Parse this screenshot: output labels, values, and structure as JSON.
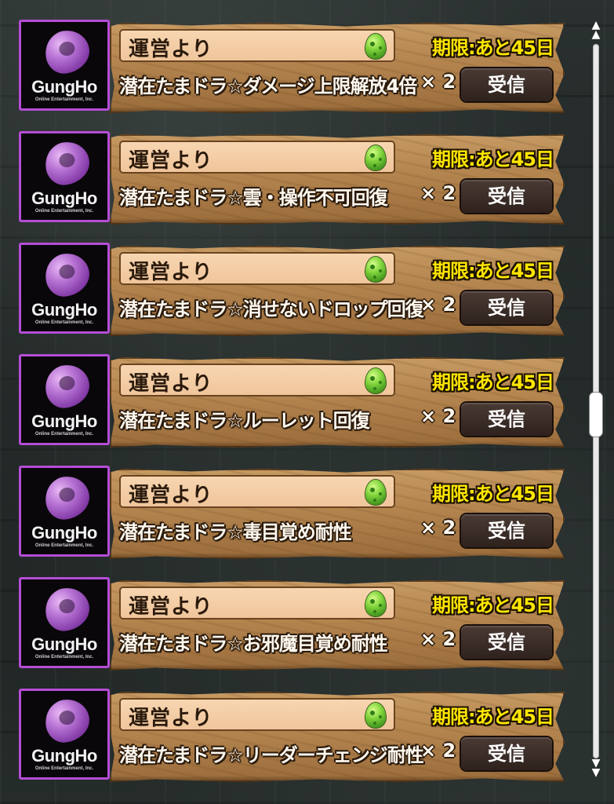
{
  "mail": {
    "items": [
      {
        "sender_logo": {
          "name": "GungHo",
          "sub": "Online Entertainment, Inc."
        },
        "sender": "運営より",
        "deadline": "期限:あと45日",
        "item": "潜在たまドラ☆ダメージ上限解放4倍",
        "qty": "× 2",
        "receive_label": "受信"
      },
      {
        "sender_logo": {
          "name": "GungHo",
          "sub": "Online Entertainment, Inc."
        },
        "sender": "運営より",
        "deadline": "期限:あと45日",
        "item": "潜在たまドラ☆雲・操作不可回復",
        "qty": "× 2",
        "receive_label": "受信"
      },
      {
        "sender_logo": {
          "name": "GungHo",
          "sub": "Online Entertainment, Inc."
        },
        "sender": "運営より",
        "deadline": "期限:あと45日",
        "item": "潜在たまドラ☆消せないドロップ回復",
        "qty": "× 2",
        "receive_label": "受信"
      },
      {
        "sender_logo": {
          "name": "GungHo",
          "sub": "Online Entertainment, Inc."
        },
        "sender": "運営より",
        "deadline": "期限:あと45日",
        "item": "潜在たまドラ☆ルーレット回復",
        "qty": "× 2",
        "receive_label": "受信"
      },
      {
        "sender_logo": {
          "name": "GungHo",
          "sub": "Online Entertainment, Inc."
        },
        "sender": "運営より",
        "deadline": "期限:あと45日",
        "item": "潜在たまドラ☆毒目覚め耐性",
        "qty": "× 2",
        "receive_label": "受信"
      },
      {
        "sender_logo": {
          "name": "GungHo",
          "sub": "Online Entertainment, Inc."
        },
        "sender": "運営より",
        "deadline": "期限:あと45日",
        "item": "潜在たまドラ☆お邪魔目覚め耐性",
        "qty": "× 2",
        "receive_label": "受信"
      },
      {
        "sender_logo": {
          "name": "GungHo",
          "sub": "Online Entertainment, Inc."
        },
        "sender": "運営より",
        "deadline": "期限:あと45日",
        "item": "潜在たまドラ☆リーダーチェンジ耐性",
        "qty": "× 2",
        "receive_label": "受信"
      }
    ]
  },
  "icons": {
    "egg": "egg-icon",
    "scroll_up": "▲",
    "scroll_down": "▼"
  },
  "colors": {
    "deadline": "#ffe600",
    "logo_border": "#b54dd6",
    "panel": "#b3844e",
    "button": "#2e221d"
  }
}
